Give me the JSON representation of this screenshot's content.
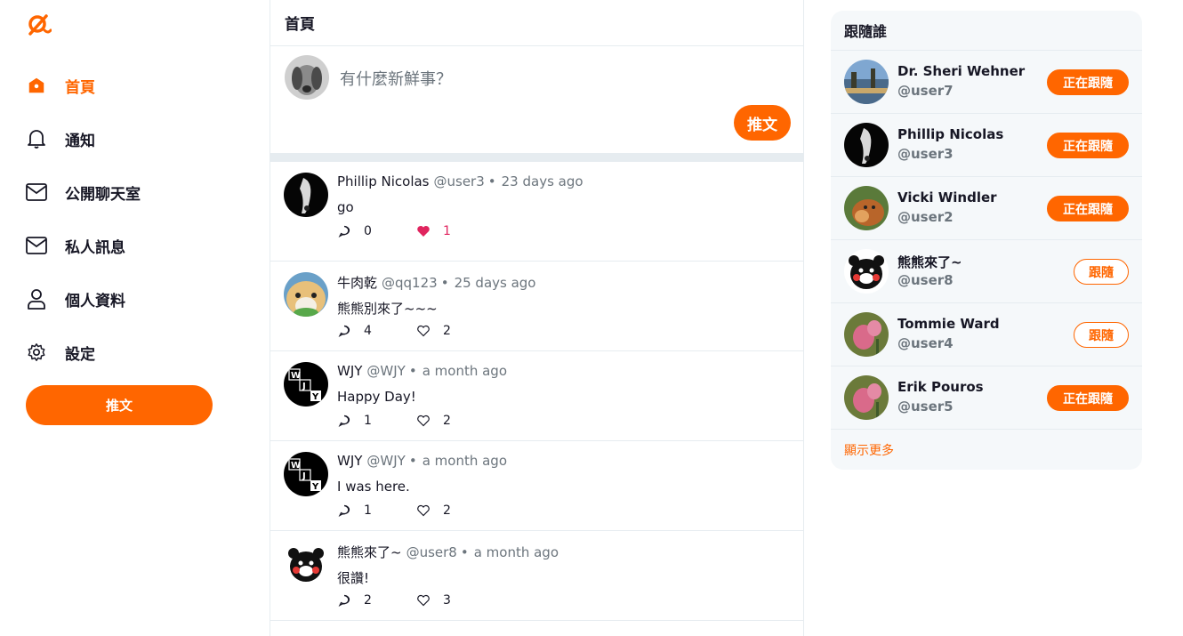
{
  "brand": {
    "accent": "#ff6600",
    "like_color": "#e0245e",
    "logo_icon": "alpha-logo-icon"
  },
  "nav": {
    "items": [
      {
        "label": "首頁",
        "icon": "home-icon",
        "active": true
      },
      {
        "label": "通知",
        "icon": "bell-icon",
        "active": false
      },
      {
        "label": "公開聊天室",
        "icon": "mail-icon",
        "active": false
      },
      {
        "label": "私人訊息",
        "icon": "mail-icon",
        "active": false
      },
      {
        "label": "個人資料",
        "icon": "user-icon",
        "active": false
      },
      {
        "label": "設定",
        "icon": "gear-icon",
        "active": false
      }
    ],
    "tweet_button": "推文"
  },
  "main": {
    "title": "首頁",
    "composer": {
      "placeholder": "有什麼新鮮事？",
      "button": "推文"
    },
    "tweets": [
      {
        "name": "Phillip Nicolas",
        "handle": "@user3",
        "time": "23 days ago",
        "text": "go",
        "replies": "0",
        "likes": "1",
        "liked": true,
        "avatar": "dog-avatar"
      },
      {
        "name": "牛肉乾",
        "handle": "@qq123",
        "time": "25 days ago",
        "text": "熊熊別來了~~~",
        "replies": "4",
        "likes": "2",
        "liked": false,
        "avatar": "hamster-avatar"
      },
      {
        "name": "WJY",
        "handle": "@WJY",
        "time": "a month ago",
        "text": "Happy Day!",
        "replies": "1",
        "likes": "2",
        "liked": false,
        "avatar": "wjy-avatar"
      },
      {
        "name": "WJY",
        "handle": "@WJY",
        "time": "a month ago",
        "text": "I was here.",
        "replies": "1",
        "likes": "2",
        "liked": false,
        "avatar": "wjy-avatar"
      },
      {
        "name": "熊熊來了~",
        "handle": "@user8",
        "time": "a month ago",
        "text": "很讚!",
        "replies": "2",
        "likes": "3",
        "liked": false,
        "avatar": "bear-avatar"
      }
    ]
  },
  "follow": {
    "title": "跟隨誰",
    "users": [
      {
        "name": "Dr. Sheri Wehner",
        "handle": "@user7",
        "button": "正在跟隨",
        "following": true,
        "avatar": "landscape-avatar"
      },
      {
        "name": "Phillip Nicolas",
        "handle": "@user3",
        "button": "正在跟隨",
        "following": true,
        "avatar": "dog-avatar"
      },
      {
        "name": "Vicki Windler",
        "handle": "@user2",
        "button": "正在跟隨",
        "following": true,
        "avatar": "puppy-avatar"
      },
      {
        "name": "熊熊來了~",
        "handle": "@user8",
        "button": "跟隨",
        "following": false,
        "avatar": "bear-avatar"
      },
      {
        "name": "Tommie Ward",
        "handle": "@user4",
        "button": "跟隨",
        "following": false,
        "avatar": "flower-avatar"
      },
      {
        "name": "Erik Pouros",
        "handle": "@user5",
        "button": "正在跟隨",
        "following": true,
        "avatar": "flower-avatar"
      }
    ],
    "show_more": "顯示更多"
  }
}
